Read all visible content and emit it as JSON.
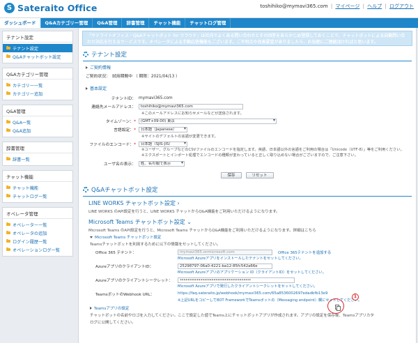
{
  "header": {
    "logo_mark": "S",
    "logo_text": "Sateraito Office",
    "user_email": "toshihiko@mymavi365.com",
    "links": [
      "マイページ",
      "ヘルプ",
      "ログアウト"
    ]
  },
  "nav": {
    "items": [
      "ダッシュボード",
      "Q&Aカテゴリー管理",
      "Q&A管理",
      "辞書管理",
      "チャット機能",
      "チャットログ管理"
    ],
    "active_index": 0
  },
  "sidebar": {
    "groups": [
      {
        "title": "テナント設定",
        "items": [
          "テナント設定",
          "Q&Aチャットボット設定"
        ],
        "active": 0
      },
      {
        "title": "Q&Aカテゴリー管理",
        "items": [
          "カテゴリー一覧",
          "カテゴリー追加"
        ],
        "active": -1
      },
      {
        "title": "Q&A管理",
        "items": [
          "Q&A一覧",
          "Q&A追加"
        ],
        "active": -1
      },
      {
        "title": "辞書管理",
        "items": [
          "辞書一覧"
        ],
        "active": -1
      },
      {
        "title": "チャット機能",
        "items": [
          "チャット機能",
          "チャットログ一覧"
        ],
        "active": -1
      },
      {
        "title": "オペレータ管理",
        "items": [
          "オペレーター一覧",
          "オペレータの追加",
          "ログイン履歴一覧",
          "オペレーションログ一覧"
        ],
        "active": -1
      }
    ]
  },
  "notice": "「サテライトオフィス・Q&Aチャットボット for ウラウド」は社内でよくある問い合わせとその回答をあらかじめ登録しておくことで、チャットボットによる自動問い合わせ対応を行えるサービスです。オペレータによる手動応答機能もございます。ご不明点や改善要望がありましたら、お気軽にご連絡頂ければと思います。",
  "tenant": {
    "title": "テナント設定",
    "contract_header": "ご契約情報",
    "contract_label": "ご契約状況：",
    "contract_value": "試用期間中 （ 期限：2021/04/13 ）",
    "basic_header": "基本設定",
    "tenant_id_label": "テナントID：",
    "tenant_id_value": "mymavi365.com",
    "email_label": "連絡先メールアドレス：",
    "email_value": "toshihiko@mymavi365.com",
    "email_note": "※このメールアドレスにお知らせメールなどが送信されます。",
    "tz_label": "タイムゾーン：",
    "tz_value": "(GMT+09:00) 東京",
    "lang_label": "言語設定：",
    "lang_value": "日本語（Japanese）",
    "lang_note": "※サイトのデフォルトの言語が変更できます。",
    "enc_label": "ファイルのエンコード：",
    "enc_value": "日本語（SJIS-JIS）",
    "enc_note1": "※ユーザー、グループなどのCSVファイルのエンコードを指定します。英語、日本語以外の言語をご利用の場合は「Unicode（UTF-8）」等をご利用ください。",
    "enc_note2": "※エクスポートとインポート処理でエンコードの種類が変わっていると正しく取り込めない場合がございますので、ご注意下さい。",
    "name_label": "ユーザ名の表示：",
    "name_value": "姓、名の順で表示",
    "required_mark": "*",
    "save_label": "保存",
    "reset_label": "リセット"
  },
  "chatbot": {
    "title": "Q&Aチャットボット設定",
    "lineworks_title": "LINE WORKS チャットボット設定 ›",
    "lineworks_desc": "LINE WORKS のAPI設定を行うと、LINE WORKS チャットからQ&A機能をご利用いただけるようになります。",
    "teams_title": "Microsoft Teams チャットボット設定 ⌄",
    "teams_desc": "Microsoft Teams のAPI設定を行うと、Microsoft Teams チャットからQ&A機能をご利用いただけるようになります。詳細はこちら",
    "teams_sub": "Microsoft Teams チャットボット設定",
    "teams_sub_desc": "Teamsチャットボットを利用するために以下の情報をセットしてください。",
    "o365_label": "Office 365 テナント：",
    "o365_value": "mymavi365.onmicrosoft.com",
    "o365_link": "Office 365テナントを追加する",
    "o365_hint": "Microsoft Azureアプリをインストールしたテナントをセットしてください。",
    "client_id_label": "AzureアプリのクライアントID：",
    "client_id_value": "25298797-06a0-4221-ba12-85fc542a66e",
    "client_id_hint": "Microsoft Azureアプリのアプリケーション ID（クライアントID）をセットしてください。",
    "secret_label": "Azureアプリのクライアントシークレット：",
    "secret_value": "••••••••••••••••••••••••••••••••••••••",
    "secret_hint": "Microsoft Azureアプリで発行したクライアントシークレットをセットしてください。",
    "webhook_label": "TeamsボットのWebhook URL：",
    "webhook_value": "https://faq.sateraito.jp/webhook/mymavi365.com/65a8536002697edadbfb13e9",
    "webhook_hint": "※上記URLをコピーしてBOT FrameworkでTeamsボットの（Messaging endpoint）欄にセットしてください。",
    "teams_app_sub": "Teamsアプリの設定",
    "teams_app_desc1": "チャットボットの名前やロゴを入力してください。ここで設定した値でTeams上にチャットボットアプリが作成されます。アプリの設定を保存後、Teamsアプリカタ",
    "teams_app_desc2": "ログに公開してください。",
    "badge_number": "1"
  }
}
